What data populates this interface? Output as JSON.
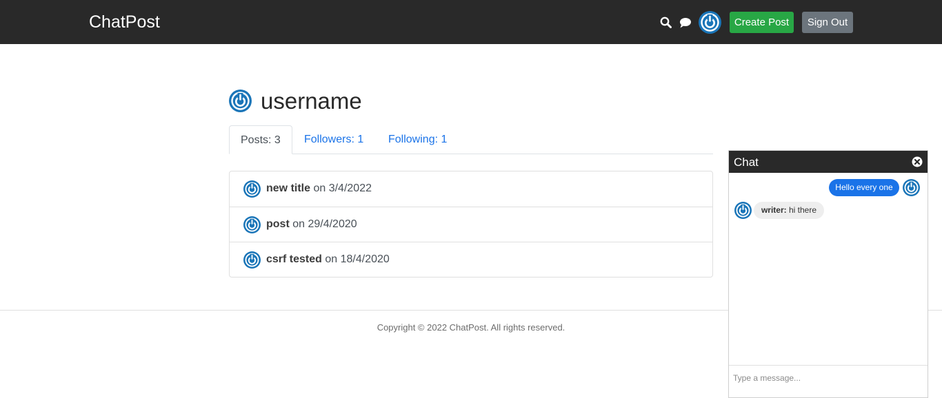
{
  "header": {
    "brand": "ChatPost",
    "icons": [
      "search-icon",
      "chat-bubble-icon",
      "avatar-power-icon"
    ],
    "create_post_label": "Create Post",
    "sign_out_label": "Sign Out"
  },
  "profile": {
    "username": "username",
    "tabs": [
      {
        "label": "Posts: 3",
        "active": true
      },
      {
        "label": "Followers: 1",
        "active": false
      },
      {
        "label": "Following: 1",
        "active": false
      }
    ],
    "posts": [
      {
        "title": "new title",
        "date_text": " on 3/4/2022"
      },
      {
        "title": "post",
        "date_text": " on 29/4/2020"
      },
      {
        "title": "csrf tested",
        "date_text": " on 18/4/2020"
      }
    ]
  },
  "footer": {
    "text": "Copyright © 2022 ChatPost. All rights reserved."
  },
  "chat": {
    "title": "Chat",
    "messages": [
      {
        "side": "right",
        "author": "",
        "text": "Hello every one"
      },
      {
        "side": "left",
        "author": "writer:",
        "text": " hi there"
      }
    ],
    "input_placeholder": "Type a message..."
  },
  "colors": {
    "header_bg": "#292929",
    "create_button": "#28a745",
    "signout_button": "#6c757d",
    "link_blue": "#1a73e8",
    "avatar_blue": "#1a75b8"
  }
}
